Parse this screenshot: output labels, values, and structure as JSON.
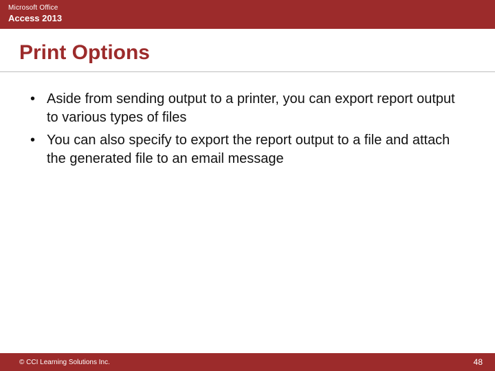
{
  "header": {
    "brand": "Microsoft Office",
    "product": "Access 2013"
  },
  "title": "Print Options",
  "bullets": [
    "Aside from sending output to a printer, you can export report output to various types of files",
    "You can also specify to export the report output to a file and attach the generated file to an email message"
  ],
  "footer": {
    "copyright": "© CCI Learning Solutions Inc.",
    "page": "48"
  }
}
